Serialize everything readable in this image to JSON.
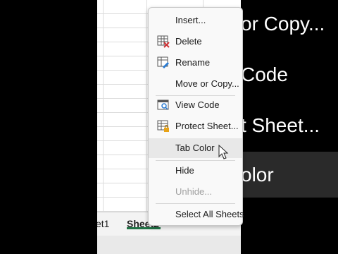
{
  "sheet_tabs": [
    {
      "label": "et1",
      "active": false
    },
    {
      "label": "Sheet2",
      "active": true
    }
  ],
  "context_menu": {
    "items": [
      {
        "label": "Insert...",
        "icon": "none",
        "enabled": true
      },
      {
        "label": "Delete",
        "icon": "delete-sheet-icon",
        "enabled": true
      },
      {
        "label": "Rename",
        "icon": "rename-sheet-icon",
        "enabled": true
      },
      {
        "label": "Move or Copy...",
        "icon": "none",
        "enabled": true
      },
      {
        "label": "View Code",
        "icon": "view-code-icon",
        "enabled": true
      },
      {
        "label": "Protect Sheet...",
        "icon": "protect-sheet-icon",
        "enabled": true
      },
      {
        "label": "Tab Color",
        "icon": "none",
        "enabled": true,
        "hovered": true
      },
      {
        "label": "Hide",
        "icon": "none",
        "enabled": true
      },
      {
        "label": "Unhide...",
        "icon": "none",
        "enabled": false
      },
      {
        "label": "Select All Sheets",
        "icon": "none",
        "enabled": true
      }
    ]
  },
  "background_zoom_text": {
    "line1": "or Copy...",
    "line2": "Code",
    "line3": "t Sheet...",
    "line4": "olor"
  },
  "colors": {
    "active_tab_underline": "#217346",
    "menu_bg": "#f9f9f9",
    "hover_bg": "#e8e8e8"
  }
}
